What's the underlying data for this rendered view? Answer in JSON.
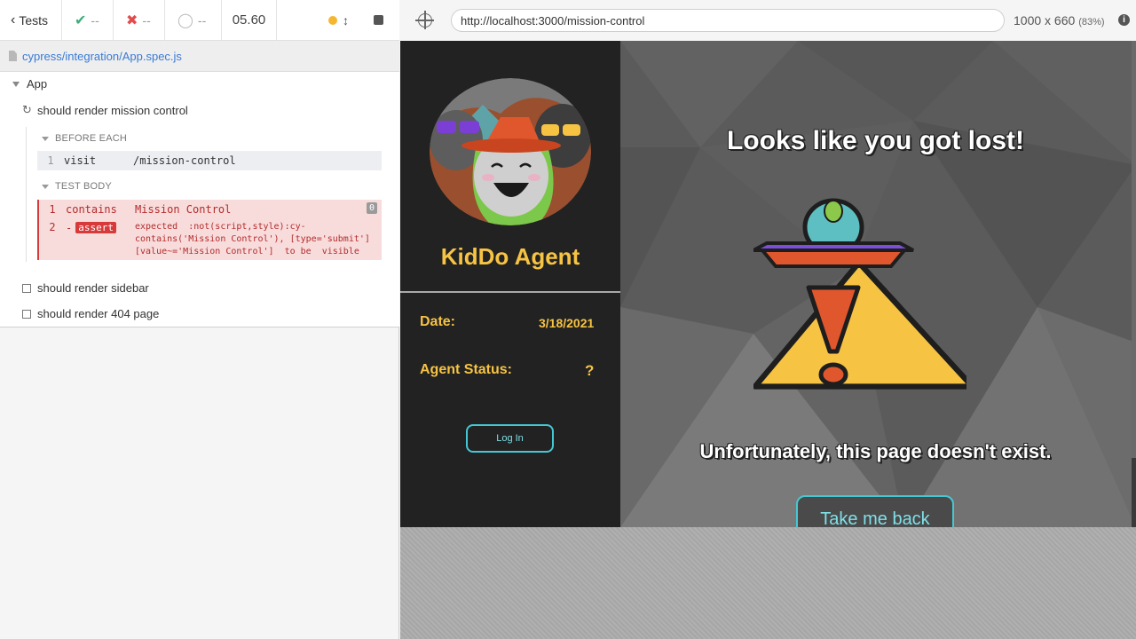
{
  "reporter": {
    "tests_label": "Tests",
    "passed": "--",
    "failed": "--",
    "pending": "--",
    "duration": "05.60",
    "spec_path": "cypress/integration/App.spec.js",
    "suite_title": "App",
    "tests": [
      {
        "title": "should render mission control",
        "state": "running"
      },
      {
        "title": "should render sidebar",
        "state": "pending"
      },
      {
        "title": "should render 404 page",
        "state": "pending"
      }
    ],
    "before_each_label": "BEFORE EACH",
    "test_body_label": "TEST BODY",
    "before_each_commands": [
      {
        "num": "1",
        "name": "visit",
        "message": "/mission-control"
      }
    ],
    "test_body_commands": [
      {
        "num": "1",
        "name": "contains",
        "message": "Mission Control",
        "count": "0"
      },
      {
        "num": "2",
        "prefix": "-",
        "name": "assert",
        "message": "expected  :not(script,style):cy-contains('Mission Control'), [type='submit'][value~='Mission Control']  to be  visible"
      }
    ]
  },
  "aut": {
    "url": "http://localhost:3000/mission-control",
    "viewport_size": "1000 x 660",
    "viewport_scale": "(83%)",
    "info_glyph": "i"
  },
  "app": {
    "agent_name": "KidDo Agent",
    "date_label": "Date:",
    "date_value": "3/18/2021",
    "status_label": "Agent Status:",
    "status_value": "?",
    "login_label": "Log In",
    "lost_title": "Looks like you got lost!",
    "not_exist_text": "Unfortunately, this page doesn't exist.",
    "take_back_label": "Take me back"
  },
  "icons": {
    "back": "chevron-left-icon",
    "passed": "check-icon",
    "failed": "x-icon",
    "pending": "circle-icon",
    "running": "spinner-icon",
    "selector": "crosshair-icon",
    "info": "info-icon"
  },
  "colors": {
    "pass": "#3cae7a",
    "fail": "#e24b4b",
    "spec_link": "#3a7bd5",
    "accent_yellow": "#f6c343",
    "accent_teal": "#45c8d3",
    "sidebar_bg": "#222222"
  }
}
